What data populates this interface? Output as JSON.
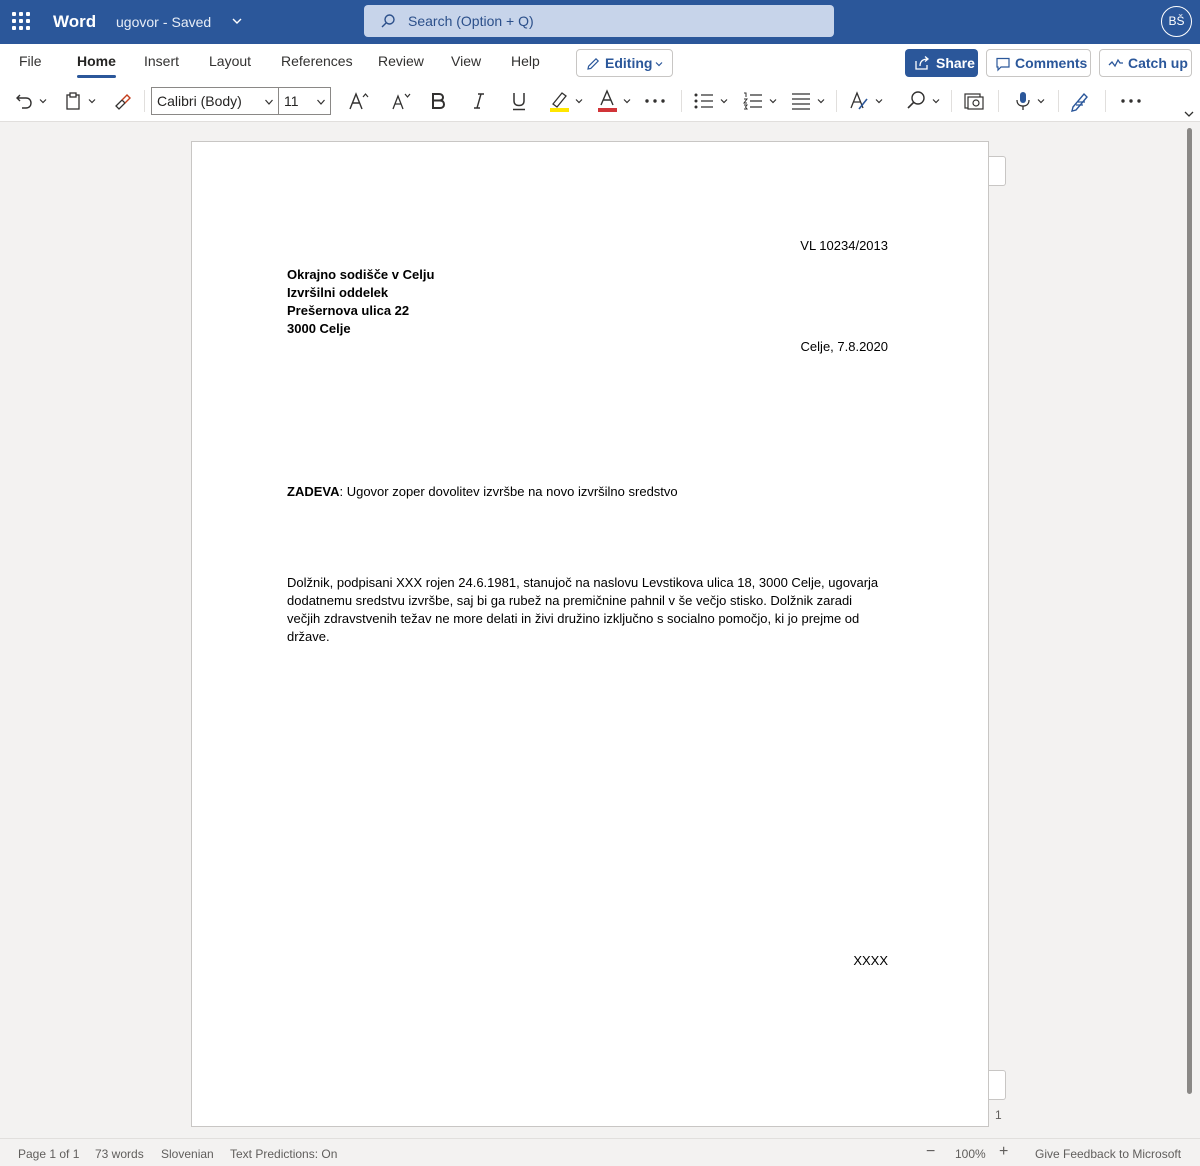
{
  "titlebar": {
    "app_name": "Word",
    "doc_name": "ugovor",
    "separator": "-",
    "status": "Saved",
    "search_placeholder": "Search (Option + Q)",
    "user_initials": "BŠ"
  },
  "menu": {
    "tabs": [
      "File",
      "Home",
      "Insert",
      "Layout",
      "References",
      "Review",
      "View",
      "Help"
    ],
    "active_tab": "Home",
    "editing_label": "Editing",
    "share_label": "Share",
    "comments_label": "Comments",
    "catchup_label": "Catch up"
  },
  "ribbon": {
    "font_name": "Calibri (Body)",
    "font_size": "11",
    "highlight_color": "#ffe600",
    "font_color": "#d13438"
  },
  "document": {
    "case_number": "VL 10234/2013",
    "recipient": [
      "Okrajno sodišče v Celju",
      "Izvršilni oddelek",
      "Prešernova ulica 22",
      "3000 Celje"
    ],
    "place_date": "Celje, 7.8.2020",
    "subject_label": "ZADEVA",
    "subject_text": ": Ugovor zoper dovolitev izvršbe na novo izvršilno sredstvo",
    "body_lines": [
      "Dolžnik, podpisani XXX rojen 24.6.1981, stanujoč na naslovu Levstikova ulica 18, 3000 Celje, ugovarja",
      "dodatnemu sredstvu izvršbe, saj bi ga rubež na premičnine pahnil v še večjo stisko. Dolžnik zaradi",
      "večjih zdravstvenih težav ne more delati in živi družino izključno s socialno pomočjo, ki jo prejme od",
      "države."
    ],
    "signature": "XXXX",
    "page_number": "1"
  },
  "statusbar": {
    "page_info": "Page 1 of 1",
    "word_count": "73 words",
    "language": "Slovenian",
    "text_predictions": "Text Predictions: On",
    "zoom": "100%",
    "feedback": "Give Feedback to Microsoft"
  }
}
